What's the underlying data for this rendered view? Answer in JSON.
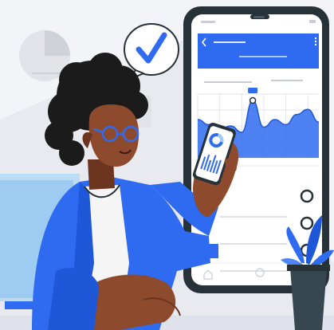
{
  "colors": {
    "background": "#f3f4f8",
    "accent_blue": "#2f6bf0",
    "light_blue": "#9ecbf2",
    "phone_frame": "#263238",
    "skin": "#8d4a2c",
    "skin_dark": "#6b3520",
    "hair": "#1b1b1b",
    "shirt": "#2f6bf0",
    "tee": "#f5f5f5",
    "plant": "#2f6bf0",
    "pot": "#37474f"
  },
  "icons": {
    "check_bubble": "check-icon",
    "back": "chevron-left-icon",
    "menu": "kebab-menu-icon",
    "radio": "radio-button-icon",
    "home": "home-icon"
  },
  "phone_chart": {
    "type": "area",
    "values": [
      3.0,
      2.6,
      2.2,
      2.5,
      2.0,
      4.5,
      2.4,
      3.0,
      2.6,
      3.4,
      3.8,
      2.8
    ],
    "highlight_index": 5,
    "ylim": [
      0,
      5
    ]
  },
  "list_rows": 3
}
